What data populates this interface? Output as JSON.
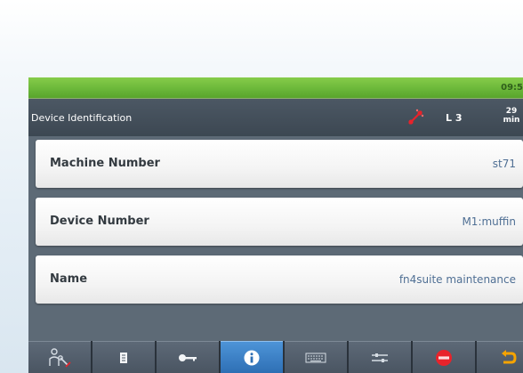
{
  "status_bar": {
    "clock": "09:5"
  },
  "header": {
    "title": "Device Identification",
    "level": "L 3",
    "time_value": "29",
    "time_unit": "min"
  },
  "rows": [
    {
      "label": "Machine Number",
      "value": "st71"
    },
    {
      "label": "Device Number",
      "value": "M1:muffin"
    },
    {
      "label": "Name",
      "value": "fn4suite maintenance"
    }
  ],
  "tabs": [
    {
      "icon": "operator-wrench-icon"
    },
    {
      "icon": "document-icon"
    },
    {
      "icon": "key-icon"
    },
    {
      "icon": "info-icon",
      "active": true
    },
    {
      "icon": "keyboard-icon"
    },
    {
      "icon": "sliders-icon"
    },
    {
      "icon": "stop-icon",
      "label": "STOP"
    },
    {
      "icon": "return-arrow-icon"
    }
  ],
  "colors": {
    "status_green": "#6cb83a",
    "active_tab_blue": "#2e6fb4",
    "value_text": "#4f6f94",
    "stop_red": "#e8232b",
    "return_orange": "#f5a300"
  }
}
